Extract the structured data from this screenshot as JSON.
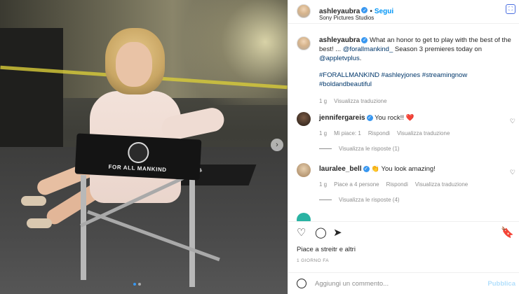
{
  "photo": {
    "chair_text": "FOR ALL MANKIND",
    "next_icon": "chevron-right-icon",
    "dots": 2,
    "active_dot": 0
  },
  "post": {
    "author": "ashleyaubra",
    "verified": true,
    "follow_label": "Segui",
    "location": "Sony Pictures Studios",
    "caption": {
      "text_1": "What an honor to get to play with the best of the best! ... ",
      "mention_1": "@forallmankind_",
      "text_2": " Season 3 premieres today on ",
      "mention_2": "@appletvplus",
      "text_3": ".",
      "hashtags": "#FORALLMANKIND #ashleyjones #streamingnow #boldandbeautiful"
    },
    "caption_time": "1 g",
    "caption_translate": "Visualizza traduzione"
  },
  "comments": [
    {
      "user": "jennifergareis",
      "text": "You rock!! ❤️",
      "time": "1 g",
      "likes": "Mi piace: 1",
      "reply": "Rispondi",
      "translate": "Visualizza traduzione",
      "replies": "Visualizza le risposte (1)"
    },
    {
      "user": "lauralee_bell",
      "text": "👏 You look amazing!",
      "time": "1 g",
      "likes": "Piace a 4 persone",
      "reply": "Rispondi",
      "translate": "Visualizza traduzione",
      "replies": "Visualizza le risposte (4)"
    }
  ],
  "footer": {
    "likes_text": "Piace a streitr e altri",
    "timestamp": "1 GIORNO FA",
    "comment_placeholder": "Aggiungi un commento...",
    "publish_label": "Pubblica"
  },
  "colors": {
    "accent": "#0095f6",
    "hashtag": "#00376b",
    "muted": "#8e8e8e"
  }
}
